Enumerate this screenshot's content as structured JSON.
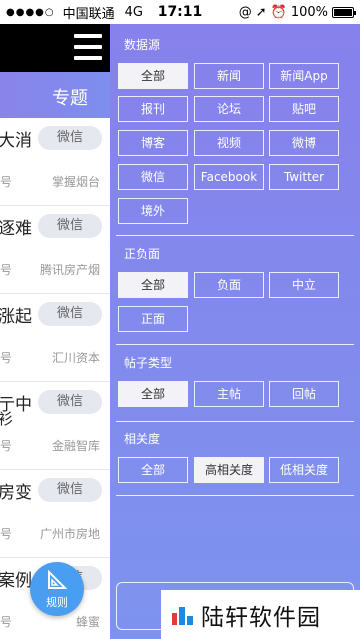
{
  "status_bar": {
    "signal_dots": "●●●●○",
    "carrier": "中国联通",
    "network": "4G",
    "time": "17:11",
    "icons": [
      "at-icon",
      "location-arrow-icon",
      "alarm-icon"
    ],
    "battery": "100%"
  },
  "left_page": {
    "subject_label": "专题",
    "rule_button_label": "规则",
    "cards": [
      {
        "title": "大消",
        "title2": "",
        "tag": "微信",
        "meta_a": "号",
        "meta_b": "掌握烟台"
      },
      {
        "title": "逐难",
        "title2": "",
        "tag": "微信",
        "meta_a": "号",
        "meta_b": "腾讯房产烟"
      },
      {
        "title": "涨起",
        "title2": "",
        "tag": "微信",
        "meta_a": "号",
        "meta_b": "汇川资本"
      },
      {
        "title": "亍中",
        "title2": "衫",
        "tag": "微信",
        "meta_a": "号",
        "meta_b": "金融智库"
      },
      {
        "title": "房变",
        "title2": "",
        "tag": "微信",
        "meta_a": "号",
        "meta_b": "广州市房地"
      },
      {
        "title": "案例/",
        "title2": "",
        "tag": "微信",
        "meta_a": "号",
        "meta_b": "蜂蜜"
      }
    ]
  },
  "filter": {
    "source": {
      "title": "数据源",
      "options": [
        "全部",
        "新闻",
        "新闻App",
        "报刊",
        "论坛",
        "贴吧",
        "博客",
        "视频",
        "微博",
        "微信",
        "Facebook",
        "Twitter",
        "境外"
      ],
      "selected": "全部"
    },
    "sentiment": {
      "title": "正负面",
      "options": [
        "全部",
        "负面",
        "中立",
        "正面"
      ],
      "selected": "全部"
    },
    "post_type": {
      "title": "帖子类型",
      "options": [
        "全部",
        "主帖",
        "回帖"
      ],
      "selected": "全部"
    },
    "relevance": {
      "title": "相关度",
      "options": [
        "全部",
        "高相关度",
        "低相关度"
      ],
      "selected": "高相关度"
    }
  },
  "watermark": {
    "text": "陆轩软件园"
  }
}
